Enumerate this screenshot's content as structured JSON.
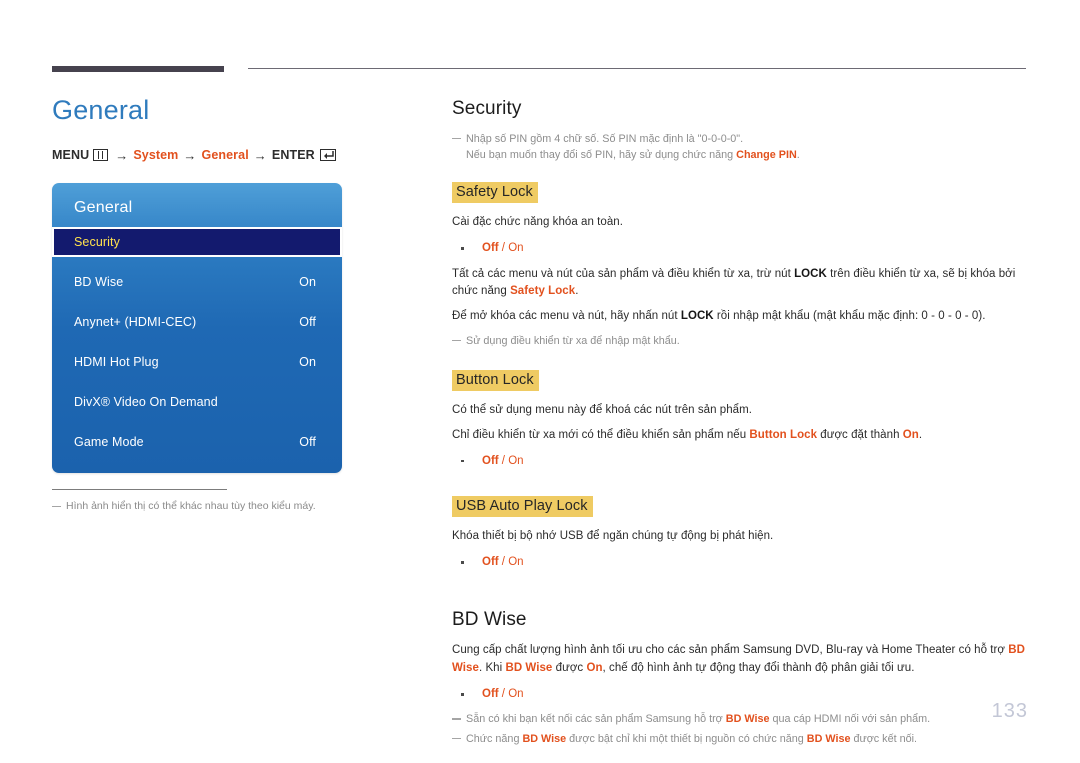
{
  "header": {
    "bar_color": "#46424e",
    "line_color": "#6d6a74"
  },
  "left": {
    "page_title": "General",
    "menu_path": {
      "menu_label": "MENU",
      "menu_icon": "menu-grid-icon",
      "arrow": "→",
      "step1": "System",
      "step2": "General",
      "enter_label": "ENTER",
      "enter_icon": "enter-return-icon"
    },
    "osd": {
      "title": "General",
      "rows": [
        {
          "label": "Security",
          "value": "",
          "selected": true
        },
        {
          "label": "BD Wise",
          "value": "On",
          "selected": false
        },
        {
          "label": "Anynet+ (HDMI-CEC)",
          "value": "Off",
          "selected": false
        },
        {
          "label": "HDMI Hot Plug",
          "value": "On",
          "selected": false
        },
        {
          "label": "DivX® Video On Demand",
          "value": "",
          "selected": false
        },
        {
          "label": "Game Mode",
          "value": "Off",
          "selected": false
        }
      ],
      "selected_bg": "#131a6e",
      "selected_text": "#ffe14d",
      "panel_blue": "#1f69b4"
    },
    "footnote": "Hình ảnh hiển thị có thể khác nhau tùy theo kiểu máy."
  },
  "right": {
    "security": {
      "heading": "Security",
      "note_line1": "Nhập số PIN gồm 4 chữ số. Số PIN mặc định là \"0-0-0-0\".",
      "note_line2_a": "Nếu bạn muốn thay đổi số PIN, hãy sử dụng chức năng ",
      "note_line2_b": "Change PIN",
      "note_line2_c": "."
    },
    "safety_lock": {
      "heading": "Safety Lock",
      "p1": "Cài đặc chức năng khóa an toàn.",
      "opt_off": "Off",
      "opt_sep": " / ",
      "opt_on": "On",
      "p2_a": "Tất cả các menu và nút của sản phẩm và điều khiển từ xa, trừ nút ",
      "p2_lock": "LOCK",
      "p2_b": " trên điều khiển từ xa, sẽ bị khóa bởi chức năng ",
      "p2_c": "Safety Lock",
      "p2_d": ".",
      "p3_a": "Để mở khóa các menu và nút, hãy nhấn nút ",
      "p3_lock": "LOCK",
      "p3_b": " rồi nhập mật khẩu (mật khẩu mặc định: 0 - 0 - 0 - 0).",
      "note": "Sử dụng điều khiển từ xa để nhập mật khẩu."
    },
    "button_lock": {
      "heading": "Button Lock",
      "p1": "Có thể sử dụng menu này để khoá các nút trên sản phẩm.",
      "p2_a": "Chỉ điều khiển từ xa mới có thể điều khiển sản phẩm nếu ",
      "p2_b": "Button Lock",
      "p2_c": " được đặt thành ",
      "p2_d": "On",
      "p2_e": ".",
      "opt_off": "Off",
      "opt_sep": " / ",
      "opt_on": "On"
    },
    "usb_auto_play_lock": {
      "heading": "USB Auto Play Lock",
      "p1": "Khóa thiết bị bộ nhớ USB để ngăn chúng tự động bị phát hiện.",
      "opt_off": "Off",
      "opt_sep": " / ",
      "opt_on": "On"
    },
    "bd_wise": {
      "heading": "BD Wise",
      "p1_a": "Cung cấp chất lượng hình ảnh tối ưu cho các sản phẩm Samsung DVD, Blu-ray và Home Theater có hỗ trợ ",
      "p1_b": "BD Wise",
      "p1_c": ". Khi ",
      "p1_d": "BD Wise",
      "p1_e": " được ",
      "p1_f": "On",
      "p1_g": ", chế độ hình ảnh tự động thay đổi thành độ phân giải tối ưu.",
      "opt_off": "Off",
      "opt_sep": " / ",
      "opt_on": "On",
      "note1_a": "Sẵn có khi bạn kết nối các sản phẩm Samsung hỗ trợ ",
      "note1_b": "BD Wise",
      "note1_c": " qua cáp HDMI nối với sản phẩm.",
      "note2_a": "Chức năng ",
      "note2_b": "BD Wise",
      "note2_c": " được bật chỉ khi một thiết bị nguồn có chức năng ",
      "note2_d": "BD Wise",
      "note2_e": " được kết nối."
    }
  },
  "footer": {
    "page_number": "133"
  },
  "colors": {
    "accent_orange": "#e2511e",
    "title_blue": "#2f7bbd",
    "highlight_yellow": "#efcb63",
    "page_num_gray": "#c3c7d6"
  }
}
